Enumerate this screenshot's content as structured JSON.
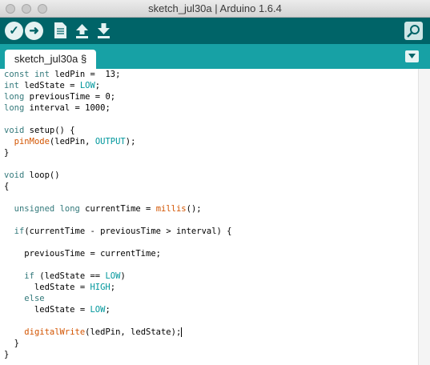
{
  "window": {
    "title": "sketch_jul30a | Arduino 1.6.4"
  },
  "toolbar": {
    "buttons": [
      {
        "name": "verify",
        "icon": "check-icon"
      },
      {
        "name": "upload",
        "icon": "arrow-right-icon"
      },
      {
        "name": "new",
        "icon": "new-file-icon"
      },
      {
        "name": "open",
        "icon": "arrow-up-icon"
      },
      {
        "name": "save",
        "icon": "arrow-down-icon"
      },
      {
        "name": "serial-monitor",
        "icon": "magnifier-icon"
      }
    ]
  },
  "tabs": [
    {
      "label": "sketch_jul30a §"
    }
  ],
  "editor": {
    "lines": [
      "const int ledPin =  13;",
      "int ledState = LOW;",
      "long previousTime = 0;",
      "long interval = 1000;",
      "",
      "void setup() {",
      "  pinMode(ledPin, OUTPUT);",
      "}",
      "",
      "void loop()",
      "{",
      "",
      "  unsigned long currentTime = millis();",
      "",
      "  if(currentTime - previousTime > interval) {",
      "",
      "    previousTime = currentTime;",
      "",
      "    if (ledState == LOW)",
      "      ledState = HIGH;",
      "    else",
      "      ledState = LOW;",
      "",
      "    digitalWrite(ledPin, ledState);",
      "  }",
      "}"
    ]
  },
  "colors": {
    "toolbar": "#006468",
    "tabstrip": "#17a1a5",
    "keyword": "#33797b",
    "function": "#d35400",
    "constant": "#00979c"
  }
}
